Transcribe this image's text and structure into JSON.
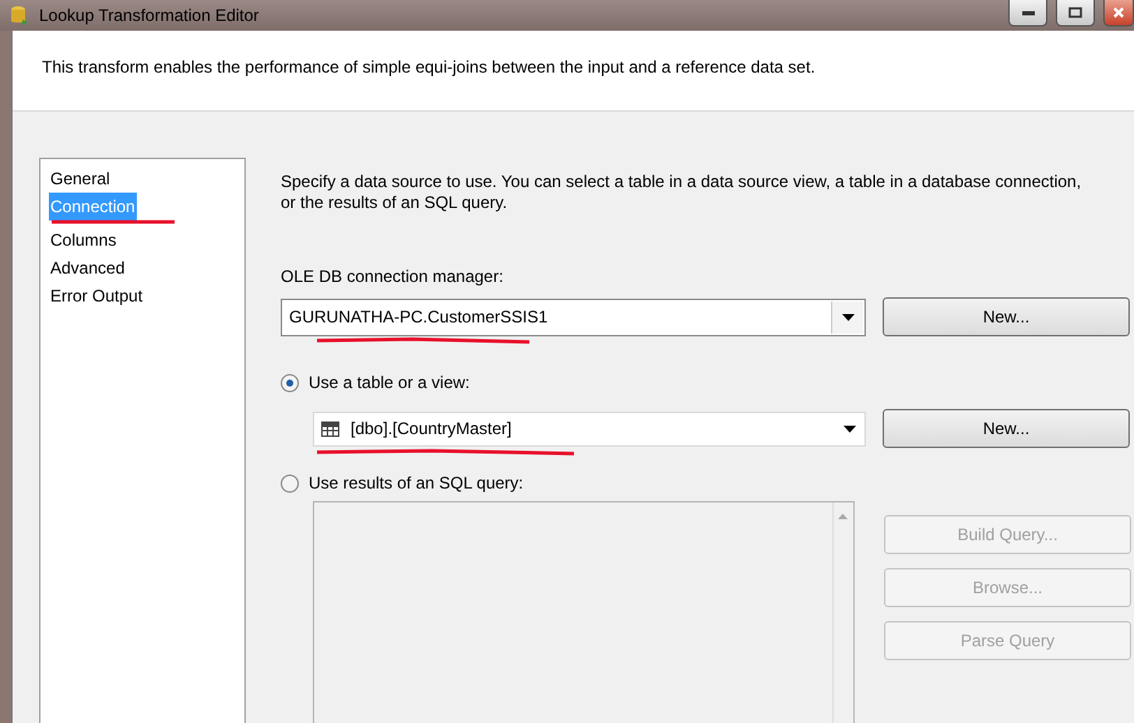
{
  "window": {
    "title": "Lookup Transformation Editor"
  },
  "description": "This transform enables the performance of simple equi-joins between the input and a reference data set.",
  "pages": [
    {
      "label": "General",
      "selected": false
    },
    {
      "label": "Connection",
      "selected": true
    },
    {
      "label": "Columns",
      "selected": false
    },
    {
      "label": "Advanced",
      "selected": false
    },
    {
      "label": "Error Output",
      "selected": false
    }
  ],
  "connection": {
    "instruction": "Specify a data source to use. You can select a table in a data source view, a table in a database connection, or the results of an SQL query.",
    "manager_label": "OLE DB connection manager:",
    "manager_value": "GURUNATHA-PC.CustomerSSIS1",
    "manager_new": "New...",
    "options": [
      {
        "label": "Use a table or a view:",
        "selected": true
      },
      {
        "label": "Use results of an SQL query:",
        "selected": false
      }
    ],
    "table_value": "[dbo].[CountryMaster]",
    "table_new": "New...",
    "query_buttons": [
      {
        "label": "Build Query...",
        "disabled": true
      },
      {
        "label": "Browse...",
        "disabled": true
      },
      {
        "label": "Parse Query",
        "disabled": true
      }
    ]
  }
}
